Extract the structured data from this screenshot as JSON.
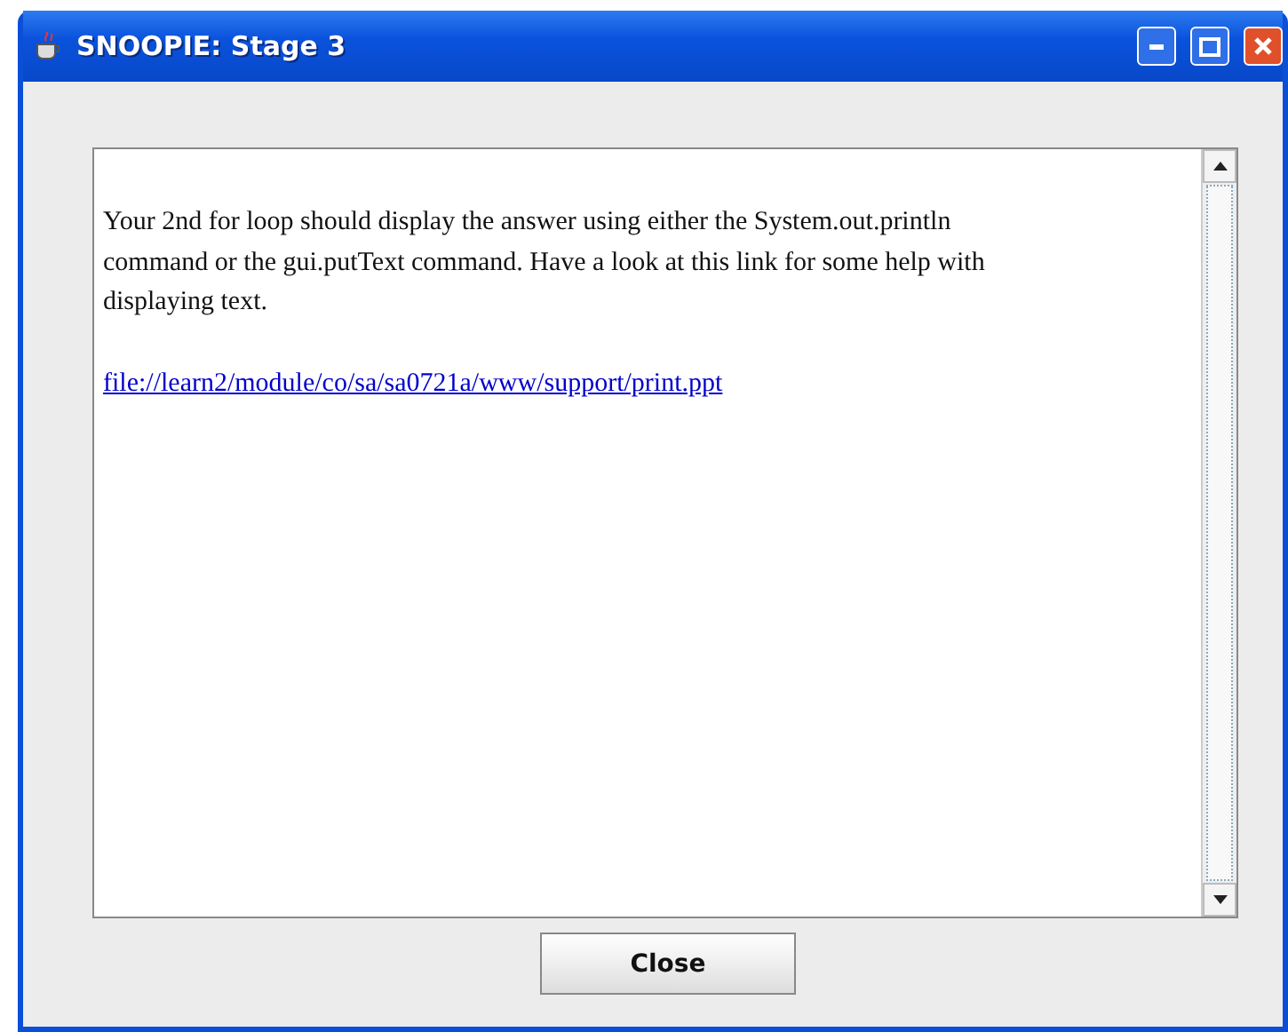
{
  "window": {
    "title": "SNOOPIE: Stage 3"
  },
  "message": {
    "text": "Your 2nd for loop should display the answer using either the System.out.println command or the gui.putText command. Have a look at this link for some help with displaying text.",
    "link": "file://learn2/module/co/sa/sa0721a/www/support/print.ppt "
  },
  "buttons": [
    "Close"
  ]
}
